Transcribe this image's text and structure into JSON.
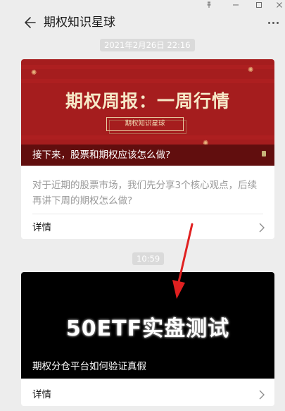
{
  "window": {
    "pin_icon": "pin-icon",
    "minimize_icon": "minimize-icon",
    "maximize_icon": "maximize-icon",
    "close_icon": "close-icon"
  },
  "header": {
    "title": "期权知识星球",
    "back_icon": "back-arrow-icon",
    "more_icon": "more-dots-icon"
  },
  "timestamps": [
    "2021年2月26日 22:16",
    "10:59"
  ],
  "articles": [
    {
      "cover_headline": "期权周报：一周行情",
      "cover_badge": "期权知识星球",
      "caption": "接下来，股票和期权应该怎么做?",
      "summary": "对于近期的股票市场，我们先分享3个核心观点，后续再讲下周的期权怎么做?",
      "detail_label": "详情"
    },
    {
      "cover_headline": "50ETF实盘测试",
      "caption": "期权分仓平台如何验证真假",
      "detail_label": "详情"
    }
  ],
  "colors": {
    "background": "#ededed",
    "cover1_red": "#a51d1e",
    "annotation_arrow": "#e02020"
  }
}
